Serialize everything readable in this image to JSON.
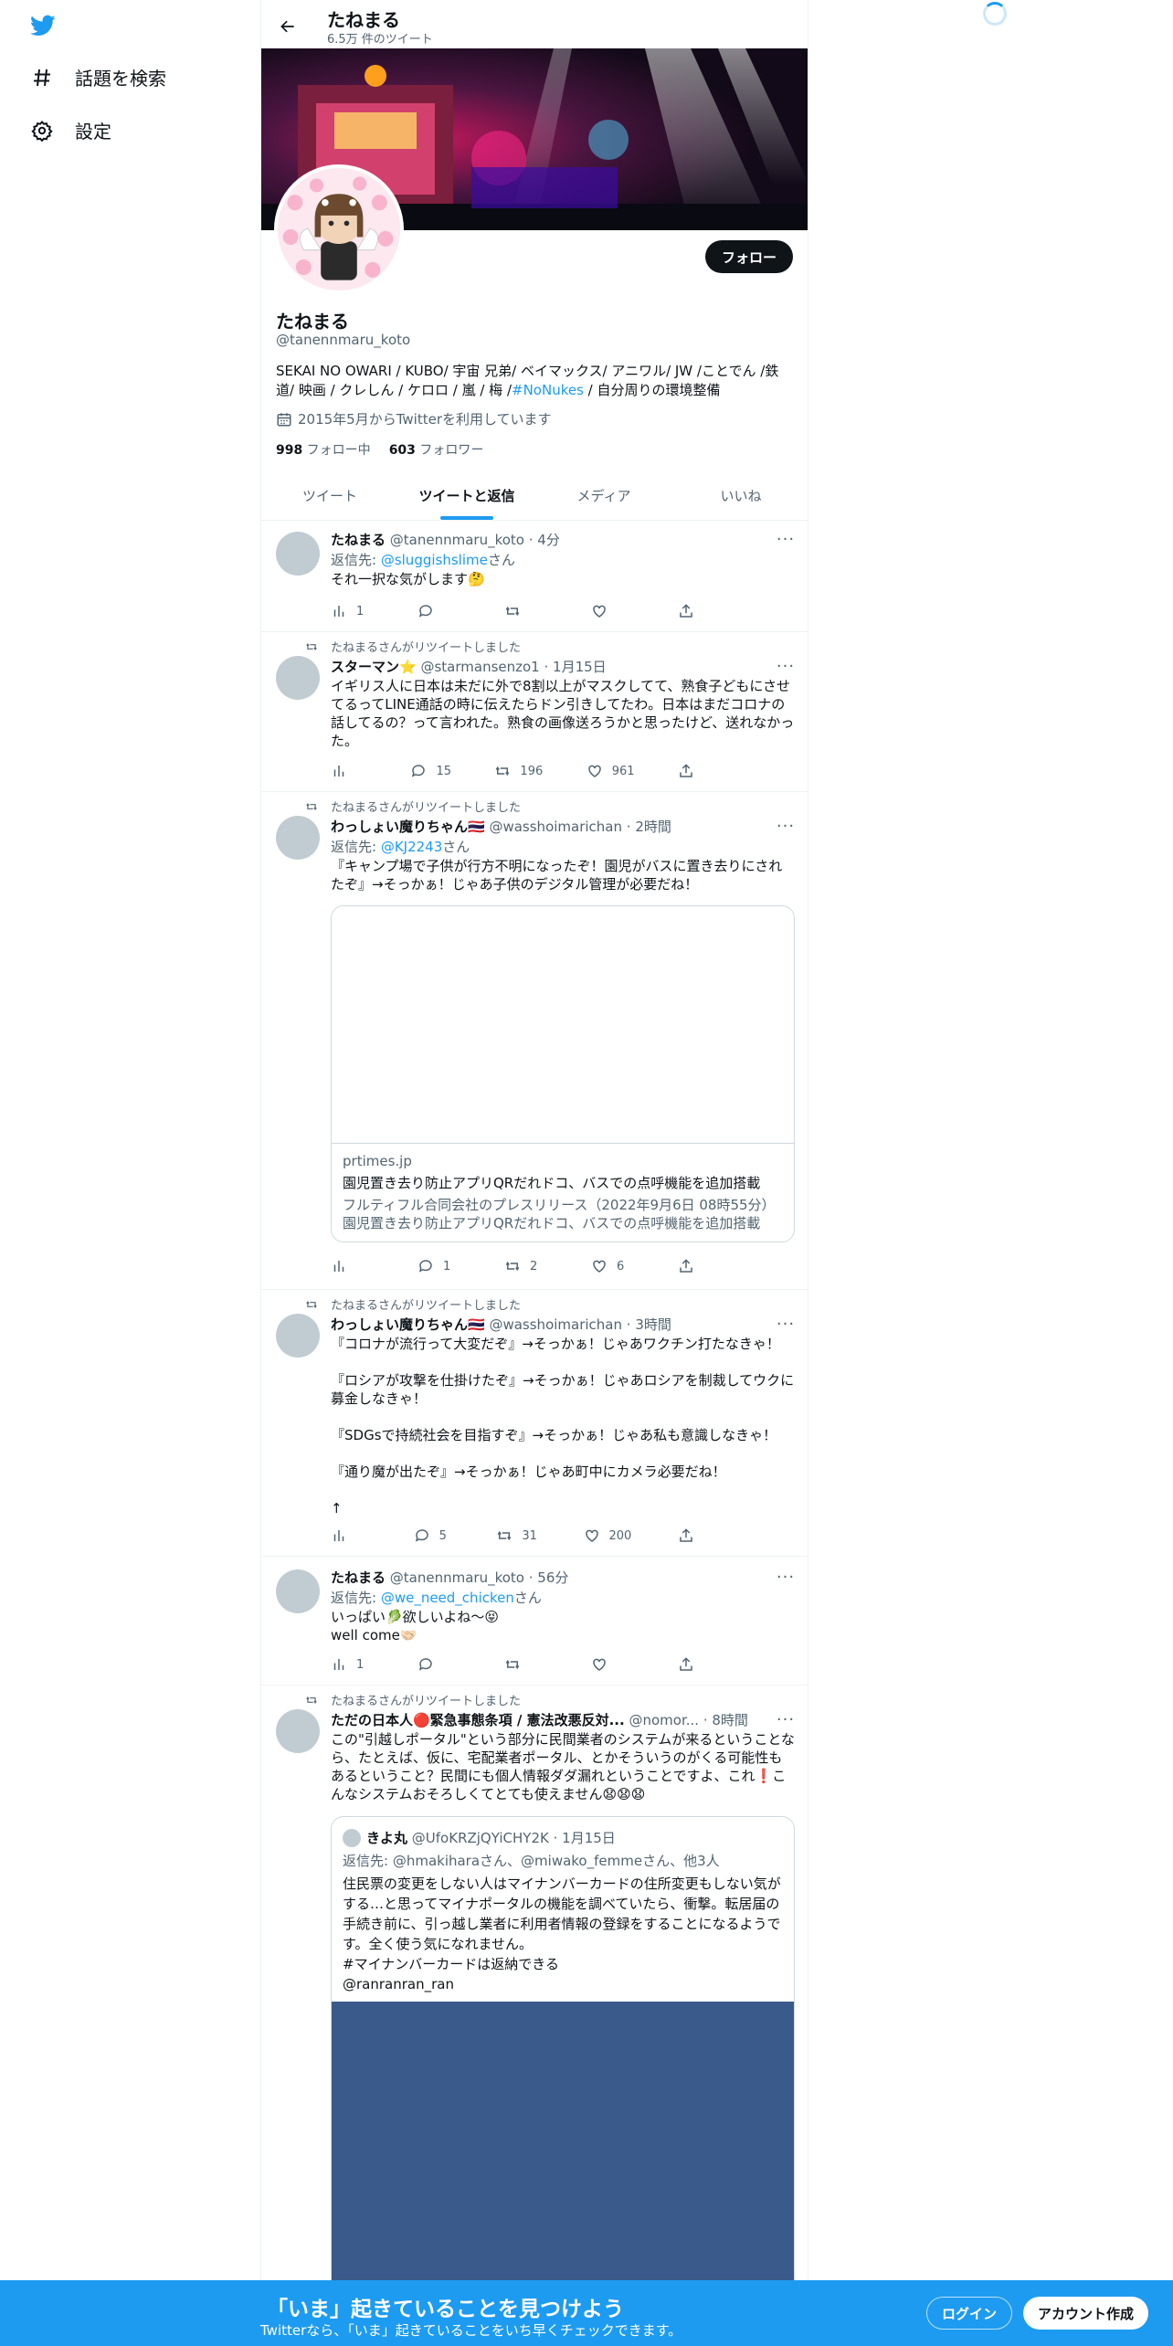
{
  "nav": {
    "logo_icon": "twitter-bird-icon",
    "items": [
      {
        "label": "話題を検索",
        "icon": "hashtag-icon"
      },
      {
        "label": "設定",
        "icon": "gear-icon"
      }
    ]
  },
  "header": {
    "name": "たねまる",
    "tweet_count": "6.5万 件のツイート"
  },
  "profile": {
    "follow_label": "フォロー",
    "name": "たねまる",
    "handle": "@tanennmaru_koto",
    "bio_before": "SEKAI NO OWARI / KUBO/ 宇宙 兄弟/ ベイマックス/ アニワル/ JW /ことでん /鉄道/ 映画 / クレしん / ケロロ / 嵐 / 梅 /",
    "bio_link": "#NoNukes",
    "bio_after": " / 自分周りの環境整備",
    "joined": "2015年5月からTwitterを利用しています",
    "following_count": "998",
    "following_label": " フォロー中",
    "followers_count": "603",
    "followers_label": " フォロワー"
  },
  "tabs": [
    "ツイート",
    "ツイートと返信",
    "メディア",
    "いいね"
  ],
  "active_tab": "ツイートと返信",
  "tweets": [
    {
      "name": "たねまる",
      "handle": "@tanennmaru_koto",
      "time": "· 4分",
      "reply_prefix": "返信先: ",
      "reply_to": "@sluggishslime",
      "reply_suffix": "さん",
      "text": "それ一択な気がします🤔",
      "views": "1",
      "replies": "",
      "retweets": "",
      "likes": ""
    },
    {
      "retweet_label": "たねまるさんがリツイートしました",
      "name": "スターマン⭐",
      "handle": "@starmansenzo1",
      "time": "· 1月15日",
      "text": "イギリス人に日本は未だに外で8割以上がマスクしてて、熟食子どもにさせてるってLINE通話の時に伝えたらドン引きしてたわ。日本はまだコロナの話してるの？って言われた。熟食の画像送ろうかと思ったけど、送れなかった。",
      "views": "",
      "replies": "15",
      "retweets": "196",
      "likes": "961"
    },
    {
      "retweet_label": "たねまるさんがリツイートしました",
      "name": "わっしょい魔りちゃん🇹🇭",
      "handle": "@wasshoimarichan",
      "time": "· 2時間",
      "reply_prefix": "返信先: ",
      "reply_to": "@KJ2243",
      "reply_suffix": "さん",
      "text": "『キャンプ場で子供が行方不明になったぞ！園児がバスに置き去りにされたぞ』→そっかぁ！じゃあ子供のデジタル管理が必要だね！",
      "card": {
        "domain": "prtimes.jp",
        "title": "園児置き去り防止アプリQRだれドコ、バスでの点呼機能を追加搭載",
        "description": "フルティフル合同会社のプレスリリース（2022年9月6日 08時55分）園児置き去り防止アプリQRだれドコ、バスでの点呼機能を追加搭載"
      },
      "views": "",
      "replies": "1",
      "retweets": "2",
      "likes": "6"
    },
    {
      "retweet_label": "たねまるさんがリツイートしました",
      "name": "わっしょい魔りちゃん🇹🇭",
      "handle": "@wasshoimarichan",
      "time": "· 3時間",
      "text": "『コロナが流行って大変だぞ』→そっかぁ！じゃあワクチン打たなきゃ！\n\n『ロシアが攻撃を仕掛けたぞ』→そっかぁ！じゃあロシアを制裁してウクに募金しなきゃ！\n\n『SDGsで持続社会を目指すぞ』→そっかぁ！じゃあ私も意識しなきゃ！\n\n『通り魔が出たぞ』→そっかぁ！じゃあ町中にカメラ必要だね！\n\n↑",
      "views": "",
      "replies": "5",
      "retweets": "31",
      "likes": "200"
    },
    {
      "name": "たねまる",
      "handle": "@tanennmaru_koto",
      "time": "· 56分",
      "reply_prefix": "返信先: ",
      "reply_to": "@we_need_chicken",
      "reply_suffix": "さん",
      "text": "いっぱい🥬欲しいよね〜😝\nwell come🤝🏻",
      "views": "1",
      "replies": "",
      "retweets": "",
      "likes": ""
    },
    {
      "retweet_label": "たねまるさんがリツイートしました",
      "name": "ただの日本人🔴緊急事態条項 / 憲法改悪反対...",
      "handle": "@nomor...",
      "time": "· 8時間",
      "text": "この\"引越しポータル\"という部分に民間業者のシステムが来るということなら、たとえば、仮に、宅配業者ポータル、とかそういうのがくる可能性もあるということ？民間にも個人情報ダダ漏れということですよ、これ❗こんなシステムおそろしくてとても使えません😧😧😧",
      "quote": {
        "name": "きよ丸",
        "handle": "@UfoKRZjQYiCHY2K",
        "time": "· 1月15日",
        "reply": "返信先: @hmakiharaさん、@miwako_femmeさん、他3人",
        "text": "住民票の変更をしない人はマイナンバーカードの住所変更もしない気がする…と思ってマイナポータルの機能を調べていたら、衝撃。転居届の手続き前に、引っ越し業者に利用者情報の登録をすることになるようです。全く使う気になれません。\n#マイナンバーカードは返納できる\n@ranranran_ran"
      }
    }
  ],
  "bottom_bar": {
    "title": "「いま」起きていることを見つけよう",
    "subtitle": "Twitterなら、「いま」起きていることをいち早くチェックできます。",
    "login_label": "ログイン",
    "signup_label": "アカウント作成"
  },
  "colors": {
    "accent": "#1d9bf0",
    "text": "#0f1419",
    "muted": "#536471",
    "quote_image": "#3a5a8c"
  }
}
